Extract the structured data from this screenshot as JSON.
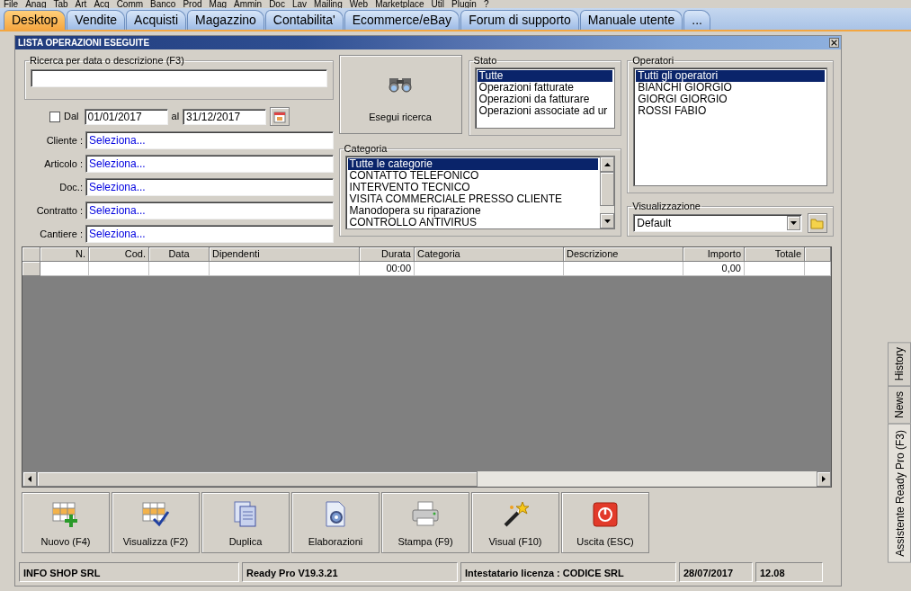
{
  "menu": [
    "File",
    "Anag",
    "Tab",
    "Art",
    "Acq",
    "Comm",
    "Banco",
    "Prod",
    "Mag",
    "Ammin",
    "Doc",
    "Lav",
    "Mailing",
    "Web",
    "Marketplace",
    "Util",
    "Plugin",
    "?"
  ],
  "tabs": [
    {
      "label": "Desktop",
      "selected": true
    },
    {
      "label": "Vendite",
      "selected": false
    },
    {
      "label": "Acquisti",
      "selected": false
    },
    {
      "label": "Magazzino",
      "selected": false
    },
    {
      "label": "Contabilita'",
      "selected": false
    },
    {
      "label": "Ecommerce/eBay",
      "selected": false
    },
    {
      "label": "Forum di supporto",
      "selected": false
    },
    {
      "label": "Manuale utente",
      "selected": false
    },
    {
      "label": "...",
      "selected": false
    }
  ],
  "window": {
    "title": "LISTA OPERAZIONI ESEGUITE"
  },
  "search": {
    "legend": "Ricerca per data o descrizione (F3)"
  },
  "date_filter": {
    "checked": false,
    "label": "Dal",
    "from": "01/01/2017",
    "to_label": "al",
    "to": "31/12/2017"
  },
  "fields": [
    {
      "label": "Cliente :",
      "value": "Seleziona..."
    },
    {
      "label": "Articolo :",
      "value": "Seleziona..."
    },
    {
      "label": "Doc.:",
      "value": "Seleziona..."
    },
    {
      "label": "Contratto :",
      "value": "Seleziona..."
    },
    {
      "label": "Cantiere :",
      "value": "Seleziona..."
    }
  ],
  "search_button": "Esegui ricerca",
  "stato": {
    "legend": "Stato",
    "items": [
      {
        "label": "Tutte",
        "selected": true
      },
      {
        "label": "Operazioni fatturate",
        "selected": false
      },
      {
        "label": "Operazioni da fatturare",
        "selected": false
      },
      {
        "label": "Operazioni associate ad ur",
        "selected": false
      }
    ]
  },
  "categoria": {
    "legend": "Categoria",
    "items": [
      {
        "label": "Tutte le categorie",
        "selected": true
      },
      {
        "label": "CONTATTO TELEFONICO",
        "selected": false
      },
      {
        "label": "INTERVENTO TECNICO",
        "selected": false
      },
      {
        "label": "VISITA COMMERCIALE PRESSO CLIENTE",
        "selected": false
      },
      {
        "label": "Manodopera su riparazione",
        "selected": false
      },
      {
        "label": "CONTROLLO ANTIVIRUS",
        "selected": false
      }
    ]
  },
  "operatori": {
    "legend": "Operatori",
    "items": [
      {
        "label": "Tutti gli operatori",
        "selected": true
      },
      {
        "label": "BIANCHI GIORGIO",
        "selected": false
      },
      {
        "label": "GIORGI GIORGIO",
        "selected": false
      },
      {
        "label": "ROSSI FABIO",
        "selected": false
      }
    ]
  },
  "visualizzazione": {
    "legend": "Visualizzazione",
    "value": "Default"
  },
  "table": {
    "columns": [
      "N.",
      "Cod.",
      "Data",
      "Dipendenti",
      "Durata",
      "Categoria",
      "Descrizione",
      "Importo",
      "Totale"
    ],
    "rows": [
      {
        "cells": [
          null,
          null,
          null,
          null,
          "00:00",
          null,
          null,
          "0,00",
          null
        ]
      }
    ]
  },
  "buttons": [
    {
      "kind": "new",
      "label": "Nuovo (F4)"
    },
    {
      "kind": "view",
      "label": "Visualizza (F2)"
    },
    {
      "kind": "duplicate",
      "label": "Duplica"
    },
    {
      "kind": "process",
      "label": "Elaborazioni"
    },
    {
      "kind": "print",
      "label": "Stampa (F9)"
    },
    {
      "kind": "wand",
      "label": "Visual (F10)"
    },
    {
      "kind": "exit",
      "label": "Uscita (ESC)"
    }
  ],
  "status_bar": [
    "INFO SHOP SRL",
    "Ready Pro V19.3.21",
    "Intestatario licenza : CODICE SRL",
    "28/07/2017",
    "12.08"
  ],
  "side_tabs": [
    {
      "label": "History",
      "selected": false
    },
    {
      "label": "News",
      "selected": false
    },
    {
      "label": "Assistente Ready Pro (F3)",
      "selected": true
    }
  ]
}
